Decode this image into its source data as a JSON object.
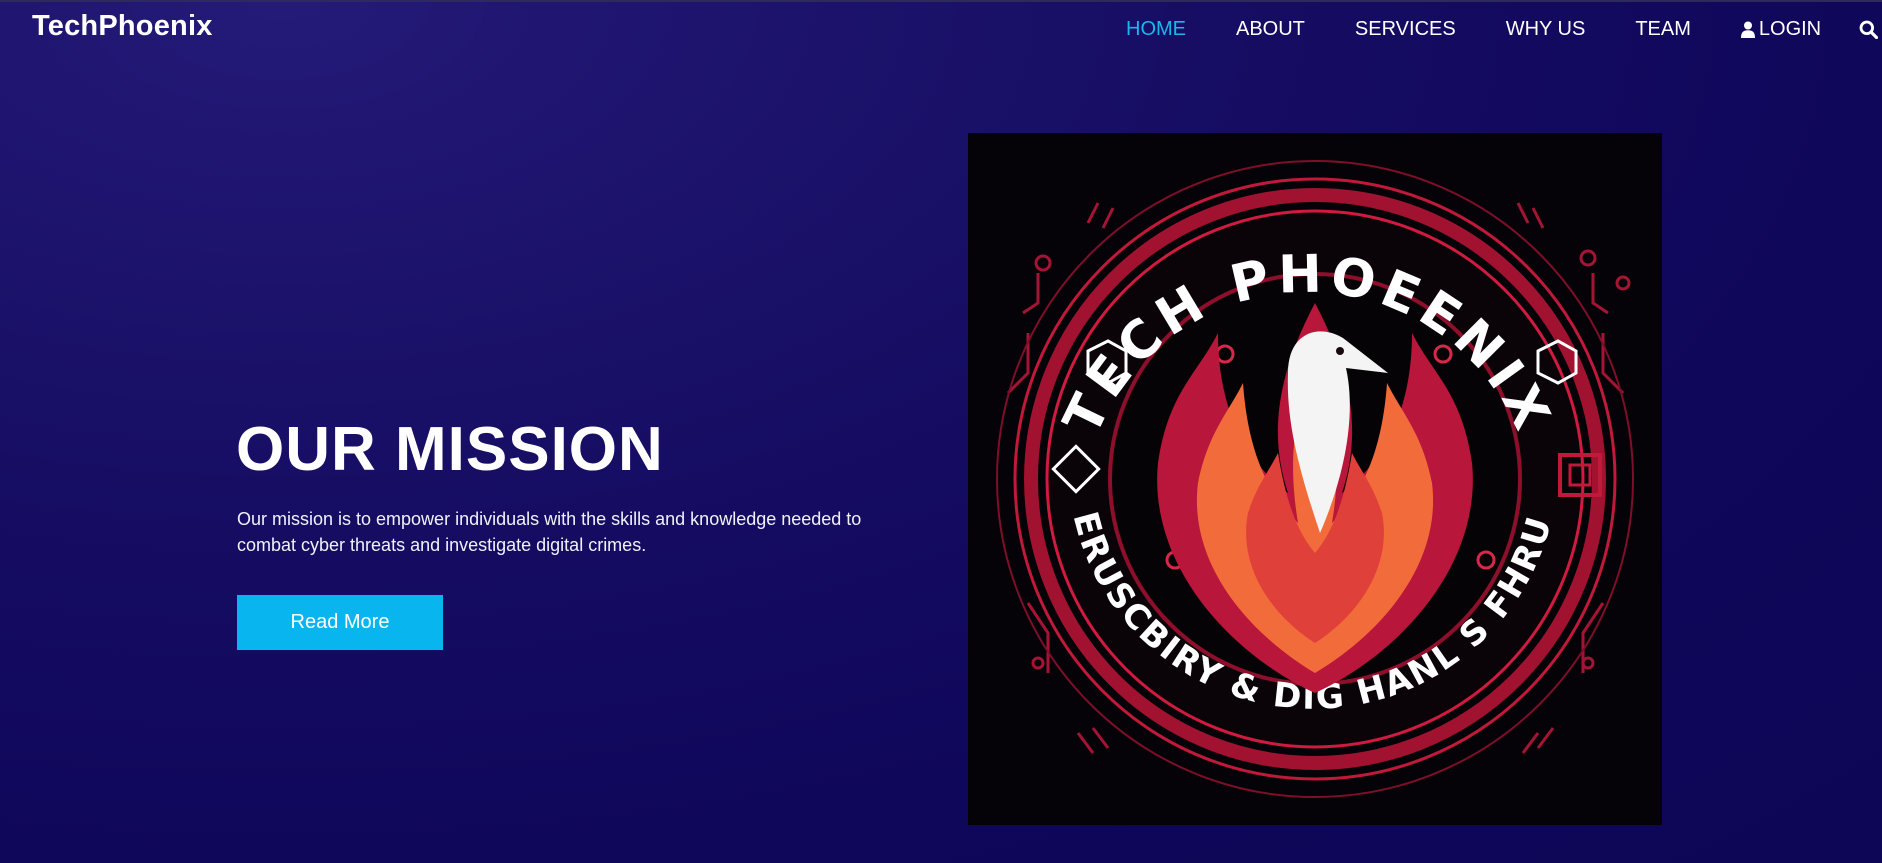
{
  "brand": {
    "name": "TechPhoenix"
  },
  "nav": {
    "items": [
      {
        "label": "HOME",
        "active": true
      },
      {
        "label": "ABOUT",
        "active": false
      },
      {
        "label": "SERVICES",
        "active": false
      },
      {
        "label": "WHY US",
        "active": false
      },
      {
        "label": "TEAM",
        "active": false
      }
    ],
    "login_label": "LOGIN",
    "login_icon": "user-icon",
    "search_icon": "search-icon"
  },
  "hero": {
    "title": "OUR MISSION",
    "text": "Our mission is to empower individuals with the skills and knowledge needed to combat cyber threats and investigate digital crimes.",
    "button_label": "Read More"
  },
  "logo_image": {
    "top_text": "TECH PHOEENIX",
    "bottom_text": "CEPERUSCBIRY & DIG HANL S FHRUIICS"
  },
  "colors": {
    "accent": "#08b5ee",
    "background": "#120a60",
    "active_nav": "#18b7ee",
    "logo_red": "#c0193a",
    "flame_orange": "#f26b3a"
  }
}
